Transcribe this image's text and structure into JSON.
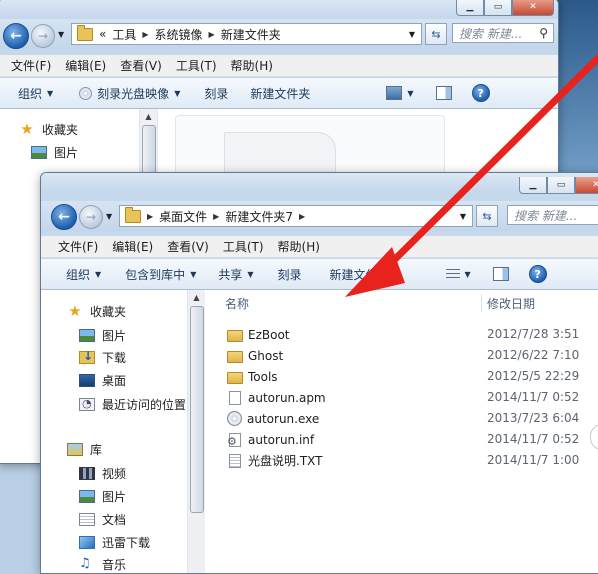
{
  "back_window": {
    "address": {
      "overflow": "«",
      "crumbs": [
        "工具",
        "系统镜像",
        "新建文件夹"
      ]
    },
    "search_placeholder": "搜索 新建...",
    "menu": [
      "文件(F)",
      "编辑(E)",
      "查看(V)",
      "工具(T)",
      "帮助(H)"
    ],
    "commands": {
      "organize": "组织",
      "burn_image": "刻录光盘映像",
      "burn": "刻录",
      "new_folder": "新建文件夹"
    },
    "nav": {
      "favorites": "收藏夹",
      "pictures": "图片"
    }
  },
  "front_window": {
    "address": {
      "crumbs": [
        "桌面文件",
        "新建文件夹7"
      ]
    },
    "search_placeholder": "搜索 新建...",
    "menu": [
      "文件(F)",
      "编辑(E)",
      "查看(V)",
      "工具(T)",
      "帮助(H)"
    ],
    "commands": {
      "organize": "组织",
      "include_library": "包含到库中",
      "share": "共享",
      "burn": "刻录",
      "new_folder": "新建文件夹"
    },
    "nav": {
      "favorites": "收藏夹",
      "favorites_items": [
        "图片",
        "下载",
        "桌面",
        "最近访问的位置"
      ],
      "libraries": "库",
      "library_items": [
        "视频",
        "图片",
        "文档",
        "迅雷下载",
        "音乐"
      ]
    },
    "columns": {
      "name": "名称",
      "modified": "修改日期"
    },
    "files": [
      {
        "name": "EzBoot",
        "type": "folder",
        "date": "2012/7/28 3:51"
      },
      {
        "name": "Ghost",
        "type": "folder",
        "date": "2012/6/22 7:10"
      },
      {
        "name": "Tools",
        "type": "folder",
        "date": "2012/5/5 22:29"
      },
      {
        "name": "autorun.apm",
        "type": "file",
        "date": "2014/11/7 0:52"
      },
      {
        "name": "autorun.exe",
        "type": "exe",
        "date": "2013/7/23 6:04"
      },
      {
        "name": "autorun.inf",
        "type": "inf",
        "date": "2014/11/7 0:52"
      },
      {
        "name": "光盘说明.TXT",
        "type": "txt",
        "date": "2014/11/7 1:00"
      }
    ]
  },
  "colors": {
    "annotation_arrow": "#e8231e",
    "address_bar_border": "#8ea4bd",
    "command_text": "#1e395b"
  }
}
